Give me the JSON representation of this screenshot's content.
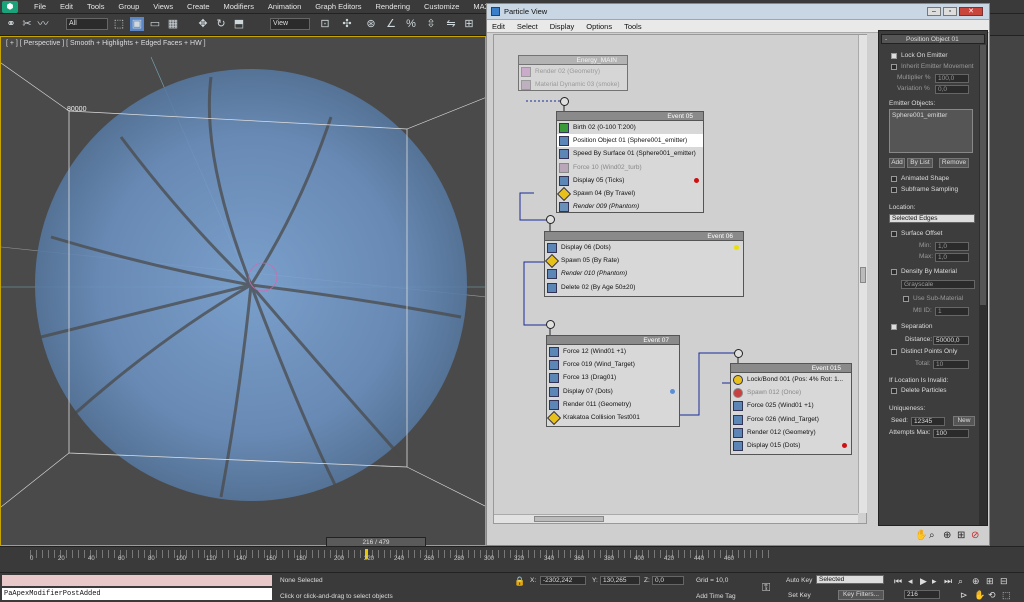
{
  "max_menu": [
    "File",
    "Edit",
    "Tools",
    "Group",
    "Views",
    "Create",
    "Modifiers",
    "Animation",
    "Graph Editors",
    "Rendering",
    "Customize",
    "MAXScript"
  ],
  "toolbar": {
    "selection_filter": "All",
    "ref_coord": "View"
  },
  "viewport": {
    "label": "[ + ] [ Perspective ] [ Smooth + Highlights + Edged Faces + HW ]",
    "grid_value": "80000"
  },
  "pview": {
    "title": "Particle View",
    "menu": [
      "Edit",
      "Select",
      "Display",
      "Options",
      "Tools"
    ],
    "energy": {
      "name": "Energy_MAIN",
      "ops": [
        "Render 02 (Geometry)",
        "Material Dynamic 03 (smoke)"
      ]
    },
    "event05": {
      "name": "Event 05",
      "ops": [
        "Birth 02 (0-100 T:200)",
        "Position Object 01 (Sphere001_emitter)",
        "Speed By Surface 01 (Sphere001_emitter)",
        "Force 10 (Wind02_turb)",
        "Display 05 (Ticks)",
        "Spawn 04 (By Travel)",
        "Render 009 (Phantom)"
      ]
    },
    "event06": {
      "name": "Event 06",
      "ops": [
        "Display 06 (Dots)",
        "Spawn 05 (By Rate)",
        "Render 010 (Phantom)",
        "Delete 02 (By Age 50±20)"
      ]
    },
    "event07": {
      "name": "Event 07",
      "ops": [
        "Force 12 (Wind01 +1)",
        "Force 019 (Wind_Target)",
        "Force 13 (Drag01)",
        "Display 07 (Dots)",
        "Render 011 (Geometry)",
        "Krakatoa Collision Test001"
      ]
    },
    "event015": {
      "name": "Event 015",
      "ops": [
        "Lock/Bond 001 (Pos: 4% Rot: 1...",
        "Spawn 012 (Once)",
        "Force 025 (Wind01 +1)",
        "Force 026 (Wind_Target)",
        "Render 012 (Geometry)",
        "Display 015 (Dots)"
      ]
    },
    "colors": {
      "red": "#d01010",
      "yellow": "#e8e000",
      "blue": "#5a8fd8"
    }
  },
  "panel": {
    "title": "Position Object 01",
    "lock_on_emitter": "Lock On Emitter",
    "inherit": "Inherit Emitter Movement",
    "multiplier_label": "Multiplier %",
    "multiplier": "100,0",
    "variation_label": "Variation %",
    "variation": "0,0",
    "emitter_objects": "Emitter Objects:",
    "emitter_item": "Sphere001_emitter",
    "add": "Add",
    "by_list": "By List",
    "remove": "Remove",
    "animated_shape": "Animated Shape",
    "subframe": "Subframe Sampling",
    "location_label": "Location:",
    "location_value": "Selected Edges",
    "surface_offset": "Surface Offset",
    "min_label": "Min:",
    "min": "1,0",
    "max_label": "Max:",
    "max": "1,0",
    "density": "Density By Material",
    "grayscale": "Grayscale",
    "use_sub": "Use Sub-Material",
    "mtl_label": "Mtl ID:",
    "mtl": "1",
    "separation": "Separation",
    "distance_label": "Distance:",
    "distance": "50000,0",
    "distinct": "Distinct Points Only",
    "total_label": "Total:",
    "total": "10",
    "invalid": "If Location Is Invalid:",
    "delete": "Delete Particles",
    "uniqueness": "Uniqueness:",
    "seed_label": "Seed:",
    "seed": "12345",
    "new": "New",
    "attempts_label": "Attempts Max:",
    "attempts": "100"
  },
  "timeline": {
    "frame": "216 / 479",
    "ticks": [
      "0",
      "20",
      "40",
      "60",
      "80",
      "100",
      "120",
      "140",
      "160",
      "180",
      "200",
      "220",
      "240",
      "260",
      "280",
      "300",
      "320",
      "340",
      "360",
      "380",
      "400",
      "420",
      "440",
      "460"
    ]
  },
  "status": {
    "script": "PaApexModifierPostAdded",
    "selected": "None Selected",
    "hint": "Click or click-and-drag to select objects",
    "x_label": "X:",
    "x": "-2302,242",
    "y_label": "Y:",
    "y": "130,265",
    "z_label": "Z:",
    "z": "0,0",
    "grid": "Grid = 10,0",
    "add_time_tag": "Add Time Tag",
    "auto_key": "Auto Key",
    "set_key": "Set Key",
    "key_mode": "Selected",
    "key_filters": "Key Filters...",
    "frame": "216"
  }
}
